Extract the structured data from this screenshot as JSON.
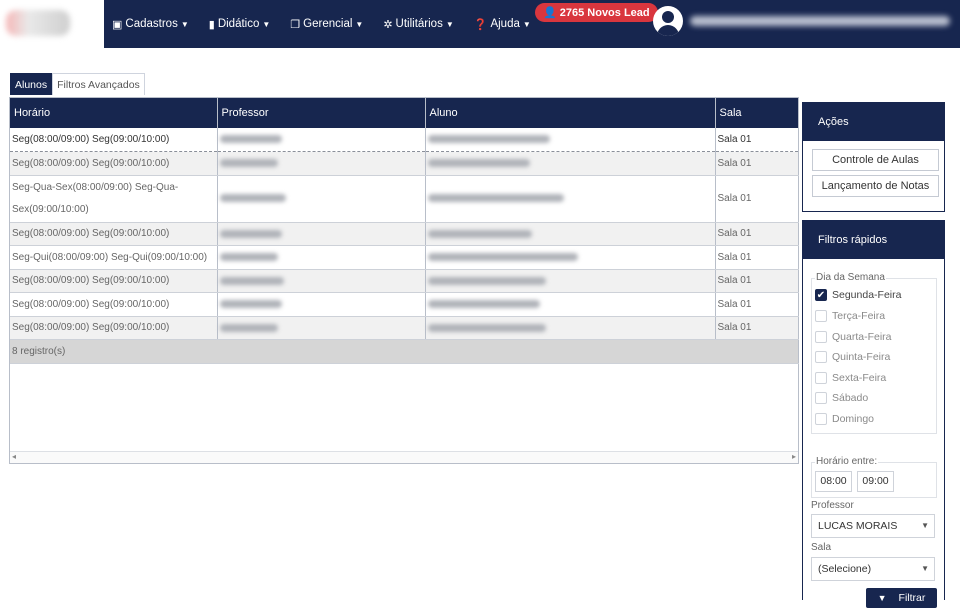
{
  "nav": {
    "items": [
      {
        "icon": "card-icon",
        "glyph": "▣",
        "label": "Cadastros"
      },
      {
        "icon": "book-icon",
        "glyph": "▮",
        "label": "Didático"
      },
      {
        "icon": "copy-icon",
        "glyph": "❐",
        "label": "Gerencial"
      },
      {
        "icon": "wrench-icon",
        "glyph": "✲",
        "label": "Utilitários"
      },
      {
        "icon": "help-icon",
        "glyph": "❓",
        "label": "Ajuda"
      }
    ],
    "lead_badge": "👤 2765 Novos Lead",
    "colors": {
      "navbar": "#17264f",
      "badge": "#d9363e"
    }
  },
  "tabs": [
    {
      "label": "Alunos",
      "active": true
    },
    {
      "label": "Filtros Avançados",
      "active": false
    }
  ],
  "grid": {
    "columns": [
      "Horário",
      "Professor",
      "Aluno",
      "Sala"
    ],
    "rows": [
      {
        "horario": "Seg(08:00/09:00) Seg(09:00/10:00)",
        "sala": "Sala 01"
      },
      {
        "horario": "Seg(08:00/09:00) Seg(09:00/10:00)",
        "sala": "Sala 01"
      },
      {
        "horario": "Seg-Qua-Sex(08:00/09:00) Seg-Qua-Sex(09:00/10:00)",
        "sala": "Sala 01"
      },
      {
        "horario": "Seg(08:00/09:00) Seg(09:00/10:00)",
        "sala": "Sala 01"
      },
      {
        "horario": "Seg-Qui(08:00/09:00) Seg-Qui(09:00/10:00)",
        "sala": "Sala 01"
      },
      {
        "horario": "Seg(08:00/09:00) Seg(09:00/10:00)",
        "sala": "Sala 01"
      },
      {
        "horario": "Seg(08:00/09:00) Seg(09:00/10:00)",
        "sala": "Sala 01"
      },
      {
        "horario": "Seg(08:00/09:00) Seg(09:00/10:00)",
        "sala": "Sala 01"
      }
    ],
    "footer": "8 registro(s)"
  },
  "acoes": {
    "title": "Ações",
    "buttons": [
      "Controle de Aulas",
      "Lançamento de Notas"
    ]
  },
  "filtros": {
    "title": "Filtros rápidos",
    "dia_legend": "Dia da Semana",
    "dias": [
      {
        "label": "Segunda-Feira",
        "checked": true
      },
      {
        "label": "Terça-Feira",
        "checked": false
      },
      {
        "label": "Quarta-Feira",
        "checked": false
      },
      {
        "label": "Quinta-Feira",
        "checked": false
      },
      {
        "label": "Sexta-Feira",
        "checked": false
      },
      {
        "label": "Sábado",
        "checked": false
      },
      {
        "label": "Domingo",
        "checked": false
      }
    ],
    "horario_legend": "Horário entre:",
    "hora_inicio": "08:00",
    "hora_fim": "09:00",
    "professor_label": "Professor",
    "professor_value": "LUCAS MORAIS",
    "sala_label": "Sala",
    "sala_value": "(Selecione)",
    "filtrar_label": "Filtrar"
  }
}
